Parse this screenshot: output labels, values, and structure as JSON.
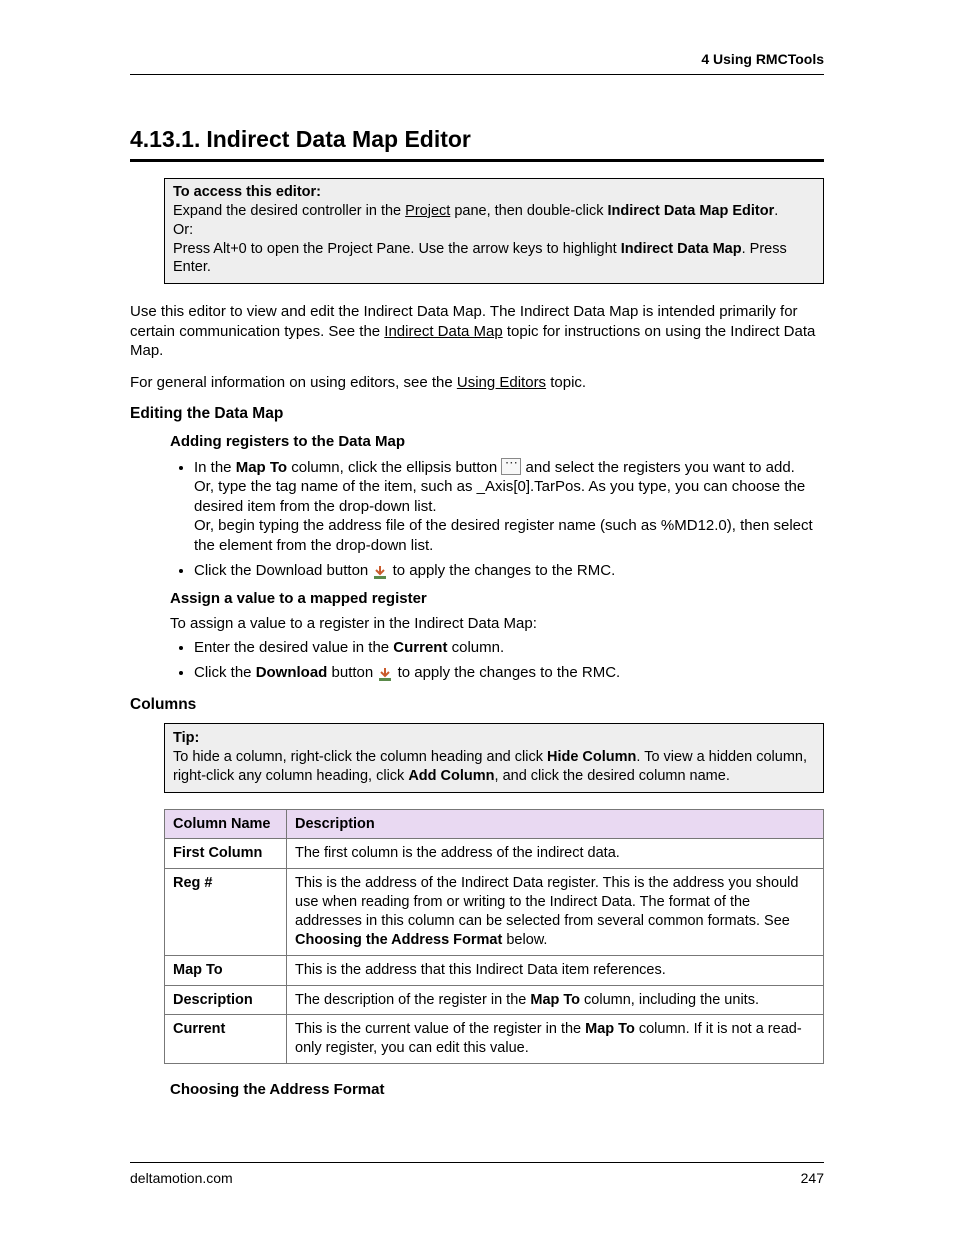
{
  "header": {
    "chapter": "4  Using RMCTools"
  },
  "title": {
    "number": "4.13.1.",
    "text": "Indirect Data Map Editor"
  },
  "access_box": {
    "label": "To access this editor:",
    "line1_pre": "Expand the desired controller in the ",
    "line1_link": "Project",
    "line1_mid": " pane, then double-click ",
    "line1_bold": "Indirect Data Map Editor",
    "line1_post": ".",
    "or": "Or:",
    "line2_pre": "Press Alt+0 to open the Project Pane. Use the arrow keys to highlight ",
    "line2_bold": "Indirect Data Map",
    "line2_post": ". Press Enter."
  },
  "intro": {
    "p1_pre": "Use this editor to view and edit the Indirect Data Map. The Indirect Data Map is intended primarily for certain communication types. See the ",
    "p1_link": "Indirect Data Map",
    "p1_post": " topic for instructions on using the Indirect Data Map.",
    "p2_pre": "For general information on using editors, see the ",
    "p2_link": "Using Editors",
    "p2_post": " topic."
  },
  "editing": {
    "heading": "Editing the Data Map",
    "sub1": "Adding registers to the Data Map",
    "li1_pre": "In the ",
    "li1_bold": "Map To",
    "li1_mid": " column, click the ellipsis button ",
    "li1_post": " and select the registers you want to add.",
    "li1_or1": "Or, type the tag name of the item, such as _Axis[0].TarPos. As you type, you can choose the desired item from the drop-down list.",
    "li1_or2": "Or, begin typing the address file of the desired register name (such as %MD12.0), then select the element from the drop-down list.",
    "li2_pre": "Click the Download button ",
    "li2_post": " to apply the changes to the RMC.",
    "sub2": "Assign a value to a mapped register",
    "assign_intro": "To assign a value to a register in the Indirect Data Map:",
    "li3_pre": "Enter the desired value in the ",
    "li3_bold": "Current",
    "li3_post": " column.",
    "li4_pre": "Click the ",
    "li4_bold": "Download",
    "li4_mid": " button ",
    "li4_post": " to apply the changes to the RMC."
  },
  "columns": {
    "heading": "Columns",
    "tip_label": "Tip:",
    "tip_1": "To hide a column, right-click the column heading and click ",
    "tip_b1": "Hide Column",
    "tip_2": ". To view a hidden column, right-click any column heading, click ",
    "tip_b2": "Add Column",
    "tip_3": ", and click the desired column name.",
    "th1": "Column Name",
    "th2": "Description",
    "rows": [
      {
        "name": "First Column",
        "desc_pre": "The first column is the address of the indirect data.",
        "desc_bold": "",
        "desc_post": ""
      },
      {
        "name": "Reg #",
        "desc_pre": "This is the address of the Indirect Data register. This is the address you should use when reading from or writing to the Indirect Data. The format of the addresses in this column can be selected from several common formats. See ",
        "desc_bold": "Choosing the Address Format",
        "desc_post": " below."
      },
      {
        "name": "Map To",
        "desc_pre": "This is the address that this Indirect Data item references.",
        "desc_bold": "",
        "desc_post": ""
      },
      {
        "name": "Description",
        "desc_pre": "The description of the register in the ",
        "desc_bold": "Map To",
        "desc_post": " column, including the units."
      },
      {
        "name": "Current",
        "desc_pre": "This is the current value of the register in the ",
        "desc_bold": "Map To",
        "desc_post": " column. If it is not a read-only register, you can edit this value."
      }
    ],
    "sub_choose": "Choosing the Address Format"
  },
  "footer": {
    "site": "deltamotion.com",
    "page": "247"
  }
}
